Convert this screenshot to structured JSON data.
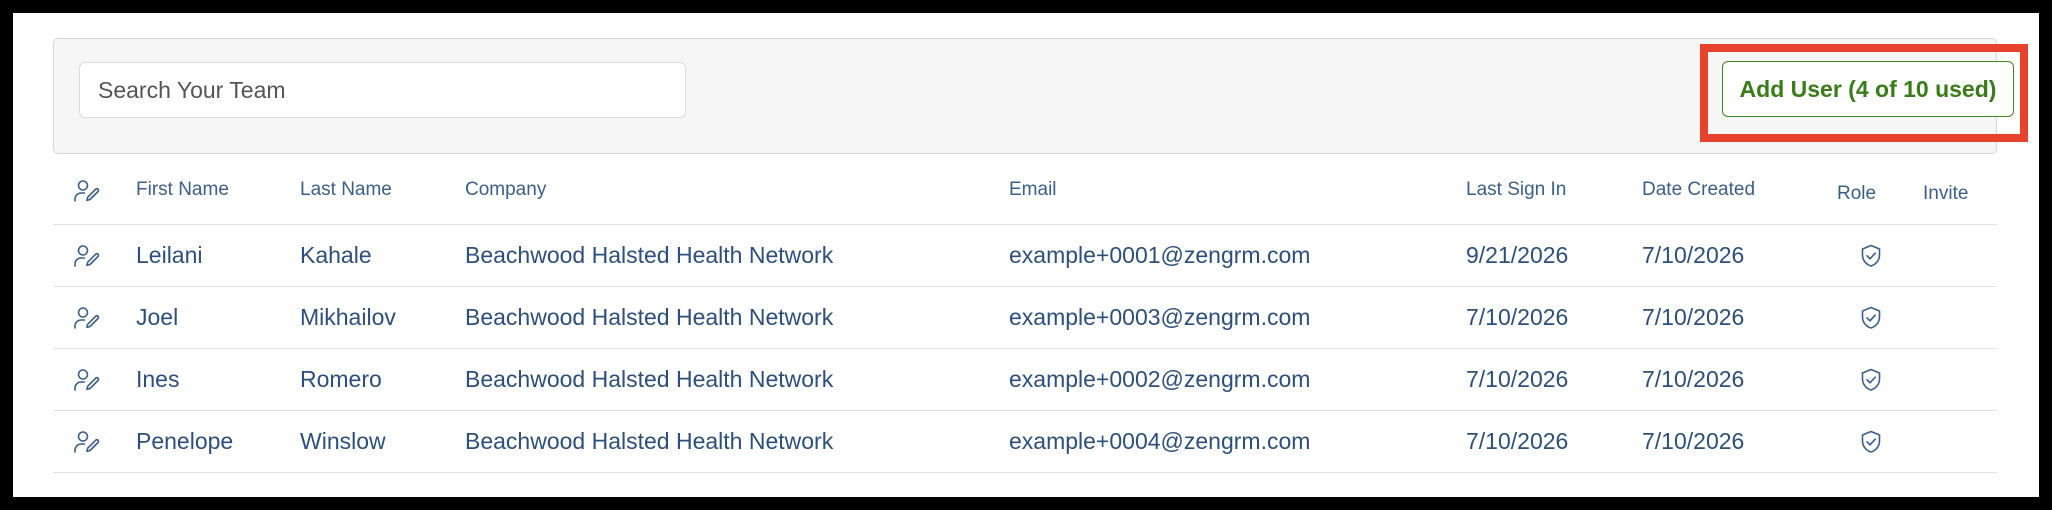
{
  "search": {
    "placeholder": "Search Your Team",
    "value": ""
  },
  "toolbar": {
    "add_user_label": "Add User (4 of 10 used)"
  },
  "table": {
    "columns": {
      "first_name": "First Name",
      "last_name": "Last Name",
      "company": "Company",
      "email": "Email",
      "last_sign_in": "Last Sign In",
      "date_created": "Date Created",
      "role": "Role",
      "invite": "Invite"
    },
    "rows": [
      {
        "first_name": "Leilani",
        "last_name": "Kahale",
        "company": "Beachwood Halsted Health Network",
        "email": "example+0001@zengrm.com",
        "last_sign_in": "9/21/2026",
        "date_created": "7/10/2026"
      },
      {
        "first_name": "Joel",
        "last_name": "Mikhailov",
        "company": "Beachwood Halsted Health Network",
        "email": "example+0003@zengrm.com",
        "last_sign_in": "7/10/2026",
        "date_created": "7/10/2026"
      },
      {
        "first_name": "Ines",
        "last_name": "Romero",
        "company": "Beachwood Halsted Health Network",
        "email": "example+0002@zengrm.com",
        "last_sign_in": "7/10/2026",
        "date_created": "7/10/2026"
      },
      {
        "first_name": "Penelope",
        "last_name": "Winslow",
        "company": "Beachwood Halsted Health Network",
        "email": "example+0004@zengrm.com",
        "last_sign_in": "7/10/2026",
        "date_created": "7/10/2026"
      }
    ]
  },
  "icons": {
    "edit_user": "user-edit-icon",
    "role": "shield-check-icon"
  },
  "colors": {
    "link": "#2c4f7e",
    "button_green": "#3a7d18",
    "highlight_red": "#e7422c"
  }
}
